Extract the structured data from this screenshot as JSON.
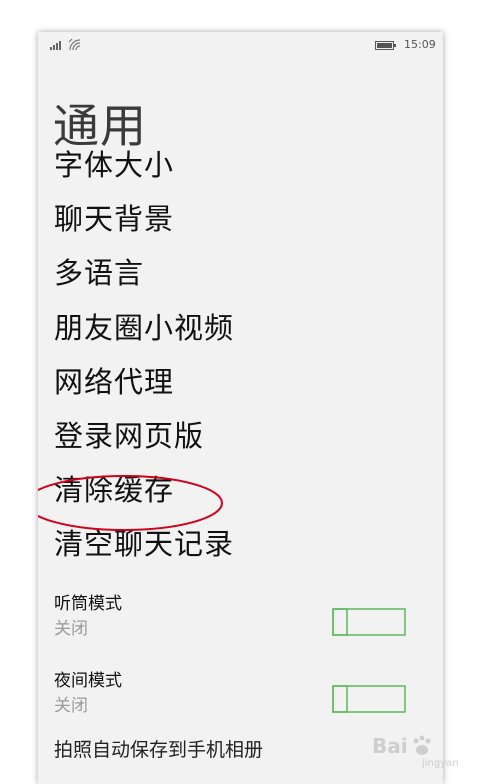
{
  "status_bar": {
    "time": "15:09",
    "icons": [
      "signal-icon",
      "wifi-icon",
      "battery-icon"
    ]
  },
  "page": {
    "title": "通用"
  },
  "menu": {
    "items": [
      {
        "label": "字体大小"
      },
      {
        "label": "聊天背景"
      },
      {
        "label": "多语言"
      },
      {
        "label": "朋友圈小视频"
      },
      {
        "label": "网络代理"
      },
      {
        "label": "登录网页版"
      },
      {
        "label": "清除缓存",
        "highlighted": true
      },
      {
        "label": "清空聊天记录"
      }
    ]
  },
  "toggles": [
    {
      "label": "听筒模式",
      "state": "关闭",
      "on": false
    },
    {
      "label": "夜间模式",
      "state": "关闭",
      "on": false
    }
  ],
  "partial_item": {
    "label": "拍照自动保存到手机相册"
  },
  "watermark": {
    "text": "Bai",
    "sub": "jingyan"
  },
  "colors": {
    "background": "#f2f2f2",
    "toggle_accent": "#5cb85c",
    "highlight_ring": "#d0021b",
    "secondary_text": "#9a9a9a"
  }
}
